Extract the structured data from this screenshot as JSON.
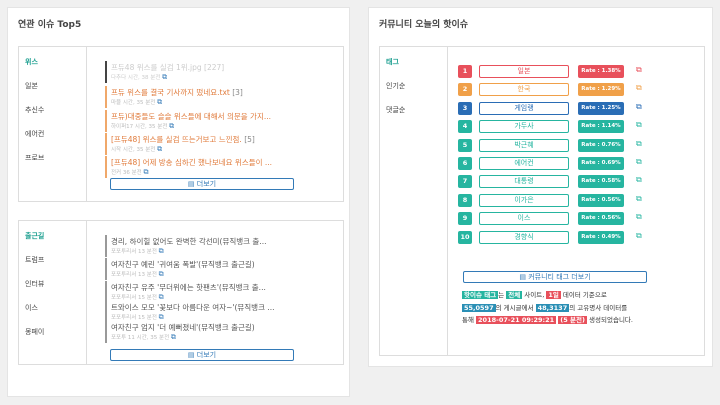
{
  "left": {
    "title": "연관 이슈 Top5",
    "section1": {
      "tabs": [
        "위스",
        "일본",
        "추신수",
        "에어컨",
        "프로브"
      ],
      "items": [
        {
          "title": "프듀48 위스를 실검 1위.jpg",
          "count": "[227]",
          "meta": "다추다 시간, 38 분전"
        },
        {
          "title": "프듀 위스를 결국 기사까지 떴네요.txt",
          "count": "[3]",
          "meta": "마블 시간, 35 분전"
        },
        {
          "title": "프듀)대중들도 슬슬 위스들에 대해서 의문을 가지...",
          "count": "",
          "meta": "하이퍼17 시간, 35 분전"
        },
        {
          "title": "[프듀48] 위스를 실검 뜨는거보고 느낀점.",
          "count": "[5]",
          "meta": "시작 시간, 35 분전"
        },
        {
          "title": "[프듀48] 어제 방송 심하긴 했나보네요 위스들이 ...",
          "count": "",
          "meta": "전커 36 분전"
        }
      ],
      "more_label": "더보기"
    },
    "section2": {
      "tabs": [
        "출근길",
        "트럼프",
        "인터뷰",
        "이스",
        "몽페이"
      ],
      "items": [
        {
          "title": "경리, 하이힐 없어도 완벽한 각선미(뮤직뱅크 출...",
          "meta": "포포투리서 13 분전"
        },
        {
          "title": "여자친구 예린 '귀여움 폭발'(뮤직뱅크 출근길)",
          "meta": "포포투리서 13 분전"
        },
        {
          "title": "여자친구 유주 '무더위에는 핫팬츠'(뮤직뱅크 출...",
          "meta": "포포투리서 15 분전"
        },
        {
          "title": "트와이스 모모 '꽃보다 아름다운 여자~'(뮤직뱅크 ...",
          "meta": "포포투리서 15 분전"
        },
        {
          "title": "여자친구 엄지 '더 예뻐졌네'(뮤직뱅크 출근길)",
          "meta": "포포투 11 시간, 35 분전"
        }
      ],
      "more_label": "더보기"
    }
  },
  "right": {
    "title": "커뮤니티 오늘의 핫이슈",
    "tabs": [
      "태그",
      "인기순",
      "댓글순"
    ],
    "tags": [
      {
        "rank": "1",
        "keyword": "일본",
        "rate": "Rate : 1.38%",
        "color": "#e8505b"
      },
      {
        "rank": "2",
        "keyword": "한국",
        "rate": "Rate : 1.29%",
        "color": "#f0a049"
      },
      {
        "rank": "3",
        "keyword": "게임랭",
        "rate": "Rate : 1.25%",
        "color": "#2a6db5"
      },
      {
        "rank": "4",
        "keyword": "가두사",
        "rate": "Rate : 1.14%",
        "color": "#26b5a0"
      },
      {
        "rank": "5",
        "keyword": "박근혜",
        "rate": "Rate : 0.76%",
        "color": "#26b5a0"
      },
      {
        "rank": "6",
        "keyword": "에어컨",
        "rate": "Rate : 0.69%",
        "color": "#26b5a0"
      },
      {
        "rank": "7",
        "keyword": "대통령",
        "rate": "Rate : 0.58%",
        "color": "#26b5a0"
      },
      {
        "rank": "8",
        "keyword": "이가은",
        "rate": "Rate : 0.56%",
        "color": "#26b5a0"
      },
      {
        "rank": "9",
        "keyword": "이스",
        "rate": "Rate : 0.56%",
        "color": "#26b5a0"
      },
      {
        "rank": "10",
        "keyword": "경향식",
        "rate": "Rate : 0.49%",
        "color": "#26b5a0"
      }
    ],
    "more_label": "커뮤니티 태그 더보기",
    "desc": {
      "p1": "핫이슈 태그",
      "p2": "는 ",
      "p3": "전체",
      "p4": " 사이트, ",
      "p5": "1일",
      "p6": " 데이터 기준으로",
      "p7": "55,0597",
      "p8": "의 게시글에서 ",
      "p9": "48,3137",
      "p10": "의 고유명사 데이터를",
      "p11": "통해 ",
      "p12": "2018-07-21 09:29:21",
      "p13": " ",
      "p14": "(5 분전)",
      "p15": " 생성되었습니다."
    }
  }
}
